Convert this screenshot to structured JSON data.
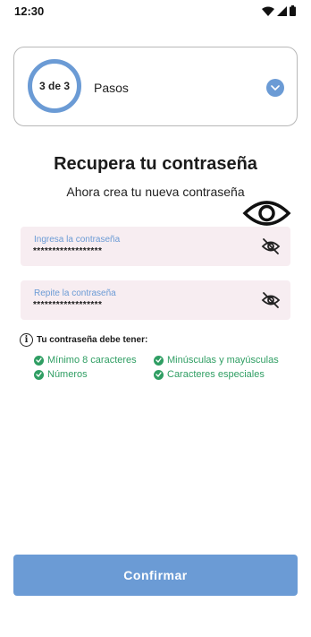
{
  "status_bar": {
    "time": "12:30"
  },
  "stepper": {
    "step_text": "3 de 3",
    "label": "Pasos"
  },
  "header": {
    "title": "Recupera tu contraseña",
    "subtitle": "Ahora crea tu nueva contraseña"
  },
  "form": {
    "password": {
      "label": "Ingresa la contraseña",
      "value": "******************"
    },
    "confirm_password": {
      "label": "Repite la contraseña",
      "value": "******************"
    }
  },
  "rules": {
    "title": "Tu contraseña debe tener:",
    "items": [
      "Mínimo 8 caracteres",
      "Minúsculas y mayúsculas",
      "Números",
      "Caracteres especiales"
    ]
  },
  "confirm_button": {
    "label": "Confirmar"
  },
  "icons": {
    "status": [
      "wifi-icon",
      "signal-icon",
      "battery-icon"
    ],
    "chevron": "chevron-down-icon",
    "eye": "eye-icon",
    "eye_off": "eye-off-icon",
    "info": "info-icon",
    "check": "check-circle-icon"
  },
  "colors": {
    "primary": "#6b9bd5",
    "success": "#2f9e63",
    "field_background": "#f7edf1",
    "text": "#1b1b1b"
  }
}
